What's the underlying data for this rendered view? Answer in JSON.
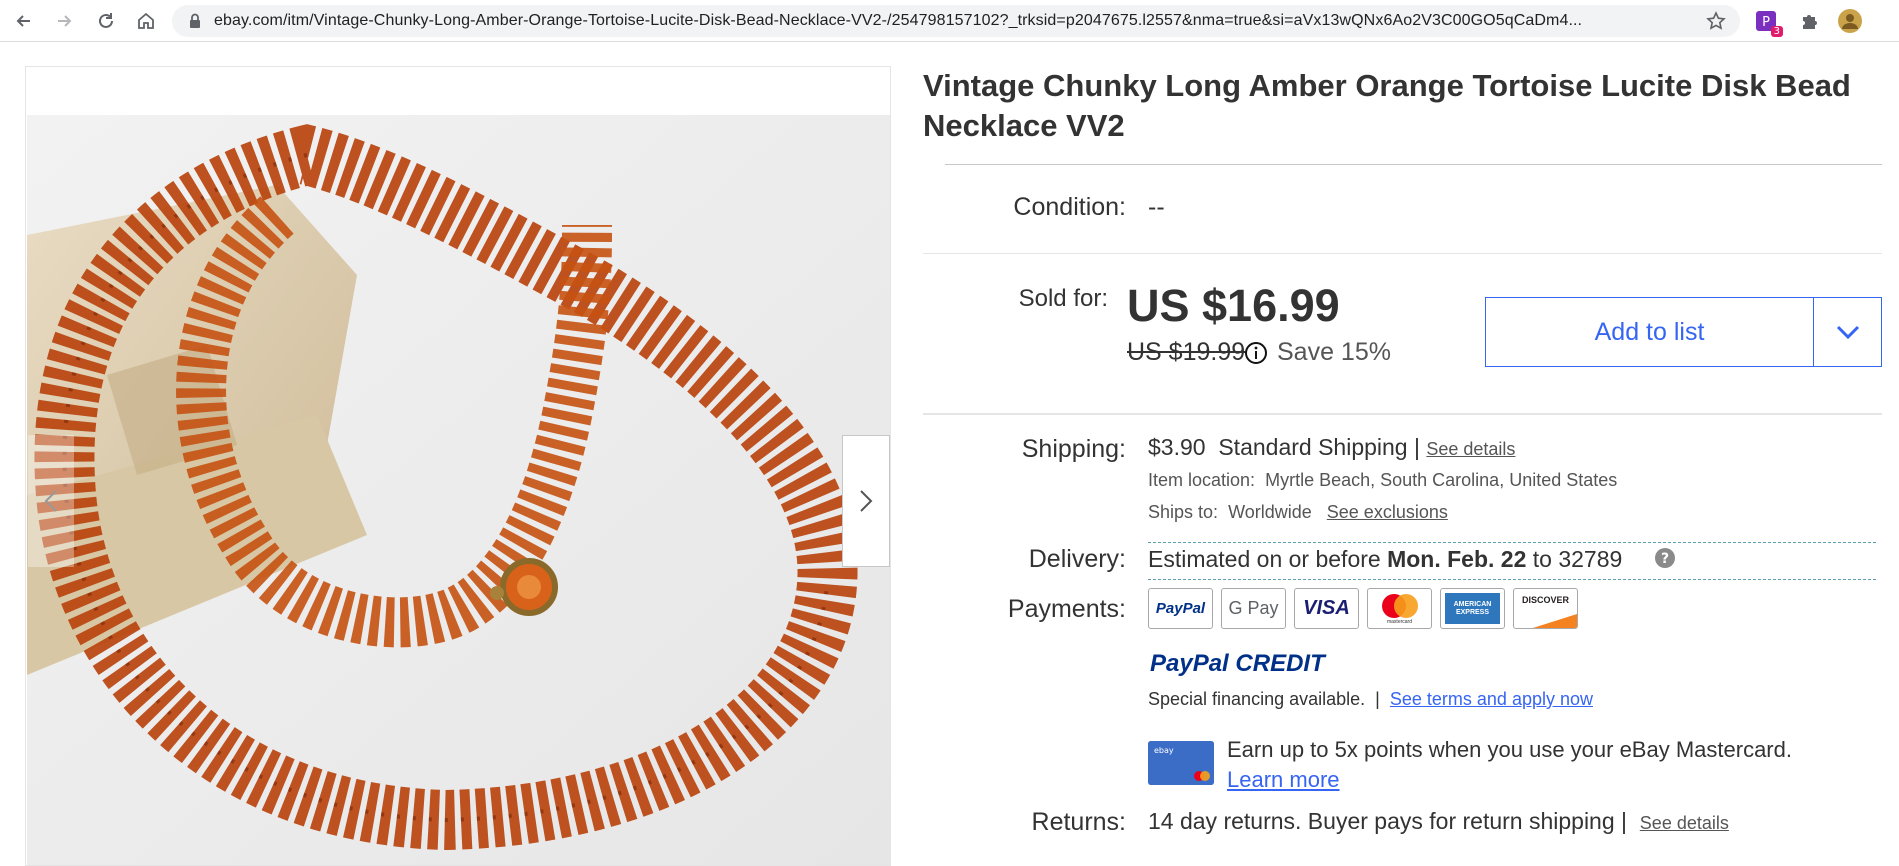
{
  "browser": {
    "url": "ebay.com/itm/Vintage-Chunky-Long-Amber-Orange-Tortoise-Lucite-Disk-Bead-Necklace-VV2-/254798157102?_trksid=p2047675.l2557&nma=true&si=aVx13wQNx6Ao2V3C00GO5qCaDm4...",
    "extension_badge": "3"
  },
  "listing": {
    "title": "Vintage Chunky Long Amber Orange Tortoise Lucite Disk Bead Necklace VV2",
    "condition_label": "Condition:",
    "condition_value": "--",
    "sold_label": "Sold for:",
    "price": "US $16.99",
    "original_price": "US $19.99",
    "save": "Save 15%",
    "add_to_list": "Add to list",
    "shipping": {
      "label": "Shipping:",
      "cost": "$3.90",
      "method": "Standard Shipping",
      "separator": "|",
      "see_details": "See details",
      "item_location_label": "Item location:",
      "item_location": "Myrtle Beach, South Carolina, United States",
      "ships_to_label": "Ships to:",
      "ships_to": "Worldwide",
      "see_exclusions": "See exclusions"
    },
    "delivery": {
      "label": "Delivery:",
      "prefix": "Estimated on or before",
      "date": "Mon. Feb. 22",
      "to": "to",
      "zip": "32789"
    },
    "payments": {
      "label": "Payments:",
      "cards": [
        "PayPal",
        "G Pay",
        "VISA",
        "mastercard",
        "AMERICAN EXPRESS",
        "DISCOVER"
      ],
      "paypal_credit_a": "PayPal",
      "paypal_credit_b": "CREDIT",
      "financing": "Special financing available.",
      "financing_sep": "|",
      "see_terms": "See terms and apply now",
      "earn": "Earn up to 5x points when you use your eBay Mastercard.",
      "learn_more": "Learn more"
    },
    "returns": {
      "label": "Returns:",
      "text": "14 day returns. Buyer pays for return shipping",
      "separator": "|",
      "see_details": "See details"
    }
  },
  "colors": {
    "accent": "#3665f3",
    "amber": "#c2410c",
    "paypal_dark": "#003087",
    "paypal_light": "#0079c1"
  }
}
